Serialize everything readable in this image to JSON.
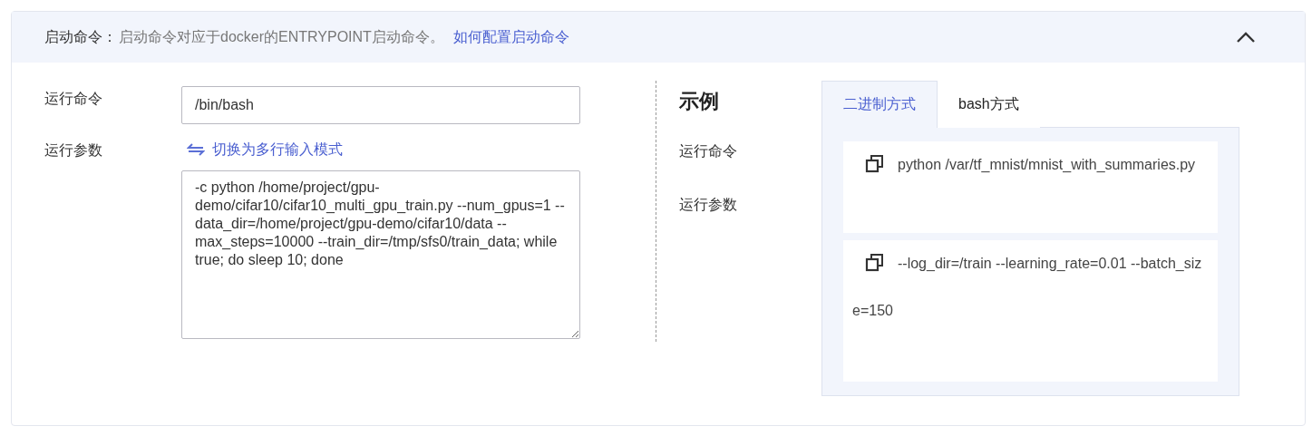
{
  "header": {
    "label": "启动命令：",
    "description": "启动命令对应于docker的ENTRYPOINT启动命令。",
    "link": "如何配置启动命令",
    "expanded": true
  },
  "form": {
    "command_label": "运行命令",
    "command_value": "/bin/bash",
    "args_label": "运行参数",
    "switch_link": "切换为多行输入模式",
    "args_value": "-c python /home/project/gpu-demo/cifar10/cifar10_multi_gpu_train.py --num_gpus=1 --data_dir=/home/project/gpu-demo/cifar10/data --max_steps=10000 --train_dir=/tmp/sfs0/train_data; while true; do sleep 10; done"
  },
  "example": {
    "title": "示例",
    "labels": [
      "运行命令",
      "运行参数"
    ],
    "tabs": [
      {
        "label": "二进制方式",
        "selected": true
      },
      {
        "label": "bash方式",
        "selected": false
      }
    ],
    "snippets": [
      "python /var/tf_mnist/mnist_with_summaries.py",
      "--log_dir=/train --learning_rate=0.01 --batch_size=150"
    ]
  }
}
